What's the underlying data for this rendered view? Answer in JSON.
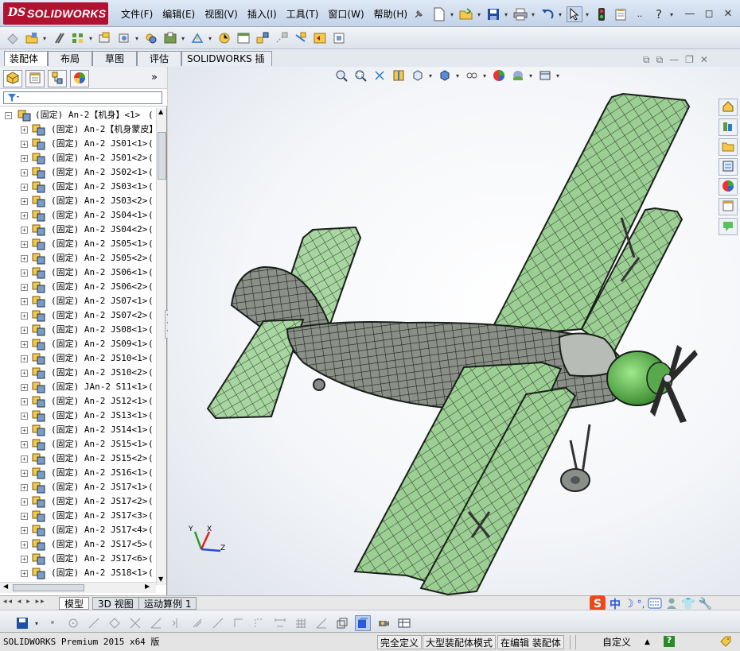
{
  "app": {
    "logo_ds": "DS",
    "logo_text": "SOLIDWORKS"
  },
  "menu": [
    "文件(F)",
    "编辑(E)",
    "视图(V)",
    "插入(I)",
    "工具(T)",
    "窗口(W)",
    "帮助(H)"
  ],
  "cmd_tabs": [
    "装配体",
    "布局",
    "草图",
    "评估",
    "SOLIDWORKS 插件"
  ],
  "tree": {
    "root": {
      "prefix": "(固定)",
      "name": "An-2【机身】<1>",
      "tail": "("
    },
    "items": [
      {
        "prefix": "(固定)",
        "name": "An-2【机身蒙皮】",
        "tail": ""
      },
      {
        "prefix": "(固定)",
        "name": "An-2 JS01<1>",
        "tail": "("
      },
      {
        "prefix": "(固定)",
        "name": "An-2 JS01<2>",
        "tail": "("
      },
      {
        "prefix": "(固定)",
        "name": "An-2 JS02<1>",
        "tail": "("
      },
      {
        "prefix": "(固定)",
        "name": "An-2 JS03<1>",
        "tail": "("
      },
      {
        "prefix": "(固定)",
        "name": "An-2 JS03<2>",
        "tail": "("
      },
      {
        "prefix": "(固定)",
        "name": "An-2 JS04<1>",
        "tail": "("
      },
      {
        "prefix": "(固定)",
        "name": "An-2 JS04<2>",
        "tail": "("
      },
      {
        "prefix": "(固定)",
        "name": "An-2 JS05<1>",
        "tail": "("
      },
      {
        "prefix": "(固定)",
        "name": "An-2 JS05<2>",
        "tail": "("
      },
      {
        "prefix": "(固定)",
        "name": "An-2 JS06<1>",
        "tail": "("
      },
      {
        "prefix": "(固定)",
        "name": "An-2 JS06<2>",
        "tail": "("
      },
      {
        "prefix": "(固定)",
        "name": "An-2 JS07<1>",
        "tail": "("
      },
      {
        "prefix": "(固定)",
        "name": "An-2 JS07<2>",
        "tail": "("
      },
      {
        "prefix": "(固定)",
        "name": "An-2 JS08<1>",
        "tail": "("
      },
      {
        "prefix": "(固定)",
        "name": "An-2 JS09<1>",
        "tail": "("
      },
      {
        "prefix": "(固定)",
        "name": "An-2 JS10<1>",
        "tail": "("
      },
      {
        "prefix": "(固定)",
        "name": "An-2 JS10<2>",
        "tail": "("
      },
      {
        "prefix": "(固定)",
        "name": "JAn-2 S11<1>",
        "tail": "("
      },
      {
        "prefix": "(固定)",
        "name": "An-2 JS12<1>",
        "tail": "("
      },
      {
        "prefix": "(固定)",
        "name": "An-2 JS13<1>",
        "tail": "("
      },
      {
        "prefix": "(固定)",
        "name": "An-2 JS14<1>",
        "tail": "("
      },
      {
        "prefix": "(固定)",
        "name": "An-2 JS15<1>",
        "tail": "("
      },
      {
        "prefix": "(固定)",
        "name": "An-2 JS15<2>",
        "tail": "("
      },
      {
        "prefix": "(固定)",
        "name": "An-2 JS16<1>",
        "tail": "("
      },
      {
        "prefix": "(固定)",
        "name": "An-2 JS17<1>",
        "tail": "("
      },
      {
        "prefix": "(固定)",
        "name": "An-2 JS17<2>",
        "tail": "("
      },
      {
        "prefix": "(固定)",
        "name": "An-2 JS17<3>",
        "tail": "("
      },
      {
        "prefix": "(固定)",
        "name": "An-2 JS17<4>",
        "tail": "("
      },
      {
        "prefix": "(固定)",
        "name": "An-2 JS17<5>",
        "tail": "("
      },
      {
        "prefix": "(固定)",
        "name": "An-2 JS17<6>",
        "tail": "("
      },
      {
        "prefix": "(固定)",
        "name": "An-2 JS18<1>",
        "tail": "("
      }
    ]
  },
  "triad": {
    "y": "Y",
    "x": "X",
    "z": "Z"
  },
  "bottom_tabs": [
    "模型",
    "3D 视图",
    "运动算例 1"
  ],
  "ime": {
    "zh": "中"
  },
  "status": {
    "product": "SOLIDWORKS Premium 2015 x64 版",
    "defined": "完全定义",
    "mode": "大型装配体模式",
    "editing": "在编辑 装配体",
    "units": "自定义",
    "help": "?"
  },
  "colors": {
    "brand": "#b0122f",
    "skin_green": "#8fc98a",
    "frame": "#3a3f3a",
    "nose_green": "#6cc35a"
  }
}
